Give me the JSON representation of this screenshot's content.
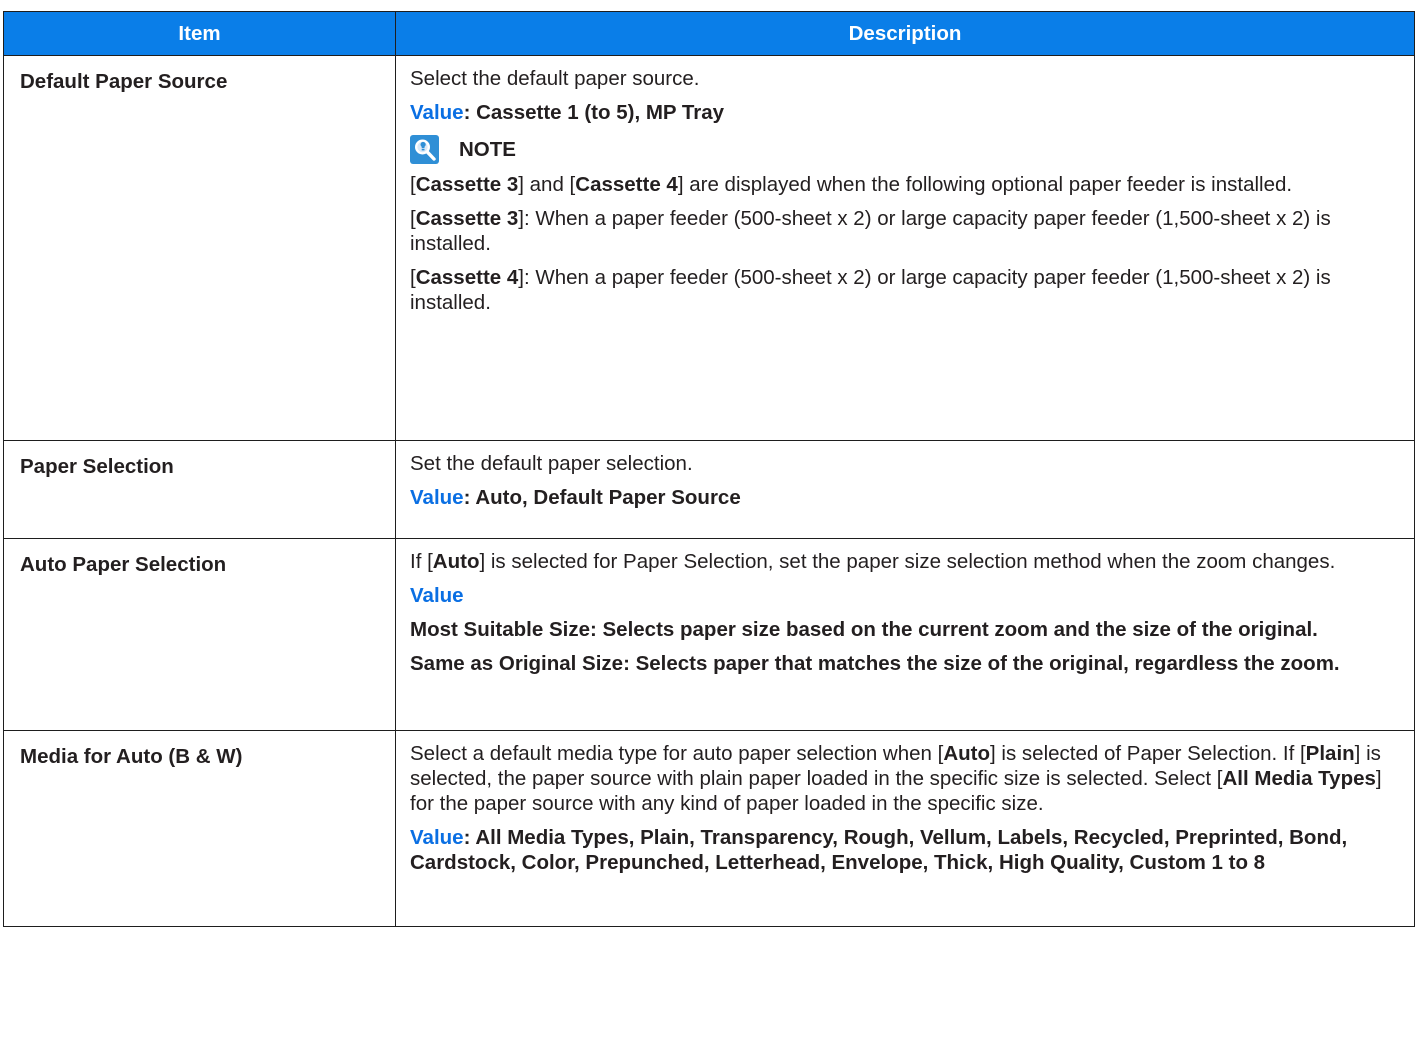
{
  "table": {
    "headers": {
      "item": "Item",
      "description": "Description"
    },
    "rows": [
      {
        "item": "Default Paper Source",
        "description": "Select the default paper source.",
        "value_label": "Value",
        "value_text": ": Cassette 1 (to 5), MP Tray",
        "note": {
          "label": "NOTE",
          "line1": {
            "o1": "[",
            "b1": "Cassette 3",
            "t1": "] and [",
            "b2": "Cassette 4",
            "t2": "] are displayed when the following optional paper feeder is installed."
          },
          "line2": {
            "o1": "[",
            "b1": "Cassette 3",
            "t1": "]: When a paper feeder (500-sheet x 2) or large capacity paper feeder (1,500-sheet x 2) is installed."
          },
          "line3": {
            "o1": "[",
            "b1": "Cassette 4",
            "t1": "]: When a paper feeder (500-sheet x 2) or large capacity paper feeder (1,500-sheet x 2) is installed."
          }
        }
      },
      {
        "item": "Paper Selection",
        "description": "Set the default paper selection.",
        "value_label": "Value",
        "value_text": ": Auto, Default Paper Source"
      },
      {
        "item": "Auto Paper Selection",
        "desc": {
          "o1": "If [",
          "b1": "Auto",
          "t1": "] is selected for Paper Selection, set the paper size selection method when the zoom changes."
        },
        "value_label": "Value",
        "option1": "Most Suitable Size: Selects paper size based on the current zoom and the size of the original.",
        "option2": "Same as Original Size: Selects paper that matches the size of the original, regardless the zoom."
      },
      {
        "item": "Media for Auto (B & W)",
        "desc": {
          "o1": "Select a default media type for auto paper selection when [",
          "b1": "Auto",
          "t1": "] is selected of Paper Selection. If [",
          "b2": "Plain",
          "t2": "] is selected, the paper source with plain paper loaded in the specific size is selected. Select [",
          "b3": "All Media Types",
          "t3": "] for the paper source with any kind of paper loaded in the specific size."
        },
        "value_label": "Value",
        "value_text": ": All Media Types, Plain, Transparency, Rough, Vellum, Labels, Recycled, Preprinted, Bond, Cardstock, Color, Prepunched, Letterhead, Envelope, Thick, High Quality, Custom 1 to 8"
      }
    ]
  },
  "colors": {
    "header_bg": "#0a7ee8",
    "value_label": "#0a6fe3",
    "note_icon": "#2f8fd6"
  },
  "icons": {
    "note": "lightbulb-magnifier-icon"
  }
}
